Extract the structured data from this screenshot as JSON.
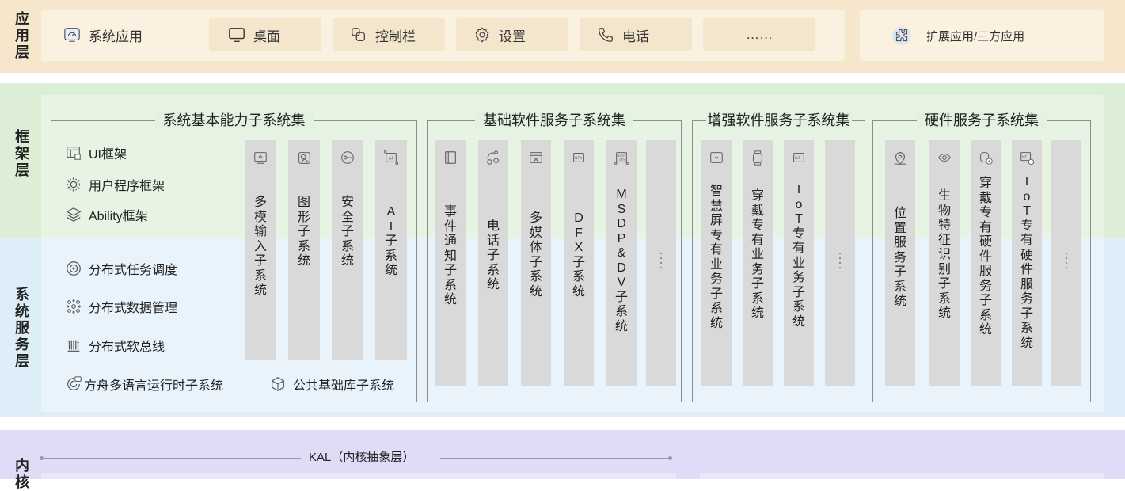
{
  "layers": {
    "app": [
      "应",
      "用",
      "层"
    ],
    "framework": [
      "框",
      "架",
      "层"
    ],
    "system": [
      "系",
      "统",
      "服",
      "务",
      "层"
    ],
    "kernel": [
      "内",
      "核"
    ]
  },
  "app_layer": {
    "items": [
      {
        "label": "系统应用",
        "icon": "system-app-icon"
      },
      {
        "label": "桌面",
        "icon": "desktop-icon"
      },
      {
        "label": "控制栏",
        "icon": "control-bar-icon"
      },
      {
        "label": "设置",
        "icon": "settings-gear-icon"
      },
      {
        "label": "电话",
        "icon": "phone-icon"
      },
      {
        "label": "……",
        "icon": ""
      }
    ],
    "extended": {
      "label": "扩展应用/三方应用",
      "icon": "extended-app-icon"
    }
  },
  "groups": {
    "basic": {
      "title": "系统基本能力子系统集",
      "features_top": [
        {
          "label": "UI框架",
          "icon": "ui-framework-icon"
        },
        {
          "label": "用户程序框架",
          "icon": "user-program-framework-icon"
        },
        {
          "label": "Ability框架",
          "icon": "ability-framework-icon"
        }
      ],
      "features_bottom": [
        {
          "label": "分布式任务调度",
          "icon": "distributed-task-icon"
        },
        {
          "label": "分布式数据管理",
          "icon": "distributed-data-icon"
        },
        {
          "label": "分布式软总线",
          "icon": "distributed-softbus-icon"
        }
      ],
      "footer": [
        {
          "label": "方舟多语言运行时子系统",
          "icon": "ark-runtime-icon"
        },
        {
          "label": "公共基础库子系统",
          "icon": "common-library-icon"
        }
      ],
      "columns": [
        {
          "text": [
            "多",
            "模",
            "输",
            "入",
            "子",
            "系",
            "统"
          ],
          "icon": "multimodal-input-icon"
        },
        {
          "text": [
            "图",
            "形",
            "子",
            "系",
            "统"
          ],
          "icon": "graphics-icon"
        },
        {
          "text": [
            "安",
            "全",
            "子",
            "系",
            "统"
          ],
          "icon": "security-icon"
        },
        {
          "text": [
            "A",
            "I",
            "子",
            "系",
            "统"
          ],
          "icon": "ai-icon"
        }
      ]
    },
    "software": {
      "title": "基础软件服务子系统集",
      "columns": [
        {
          "text": [
            "事",
            "件",
            "通",
            "知",
            "子",
            "系",
            "统"
          ],
          "icon": "event-notification-icon"
        },
        {
          "text": [
            "电",
            "话",
            "子",
            "系",
            "统"
          ],
          "icon": "telephony-icon"
        },
        {
          "text": [
            "多",
            "媒",
            "体",
            "子",
            "系",
            "统"
          ],
          "icon": "multimedia-icon"
        },
        {
          "text": [
            "D",
            "F",
            "X",
            "子",
            "系",
            "统"
          ],
          "icon": "dfx-icon"
        },
        {
          "text": [
            "M",
            "S",
            "D",
            "P",
            "&",
            "D",
            "V",
            "子",
            "系",
            "统"
          ],
          "icon": "msdp-icon"
        },
        {
          "text": [],
          "icon": ""
        }
      ]
    },
    "enhanced": {
      "title": "增强软件服务子系统集",
      "columns": [
        {
          "text": [
            "智",
            "慧",
            "屏",
            "专",
            "有",
            "业",
            "务",
            "子",
            "系",
            "统"
          ],
          "icon": "smart-screen-icon"
        },
        {
          "text": [
            "穿",
            "戴",
            "专",
            "有",
            "业",
            "务",
            "子",
            "系",
            "统"
          ],
          "icon": "wearable-icon"
        },
        {
          "text": [
            "I",
            "o",
            "T",
            "专",
            "有",
            "业",
            "务",
            "子",
            "系",
            "统"
          ],
          "icon": "iot-icon"
        },
        {
          "text": [],
          "icon": ""
        }
      ]
    },
    "hardware": {
      "title": "硬件服务子系统集",
      "columns": [
        {
          "text": [
            "位",
            "置",
            "服",
            "务",
            "子",
            "系",
            "统"
          ],
          "icon": "location-icon"
        },
        {
          "text": [
            "生",
            "物",
            "特",
            "征",
            "识",
            "别",
            "子",
            "系",
            "统"
          ],
          "icon": "biometric-icon"
        },
        {
          "text": [
            "穿",
            "戴",
            "专",
            "有",
            "硬",
            "件",
            "服",
            "务",
            "子",
            "系",
            "统"
          ],
          "icon": "wearable-hardware-icon"
        },
        {
          "text": [
            "I",
            "o",
            "T",
            "专",
            "有",
            "硬",
            "件",
            "服",
            "务",
            "子",
            "系",
            "统"
          ],
          "icon": "iot-hardware-icon"
        },
        {
          "text": [],
          "icon": ""
        }
      ]
    }
  },
  "kernel": {
    "kal_label": "KAL（内核抽象层）"
  }
}
